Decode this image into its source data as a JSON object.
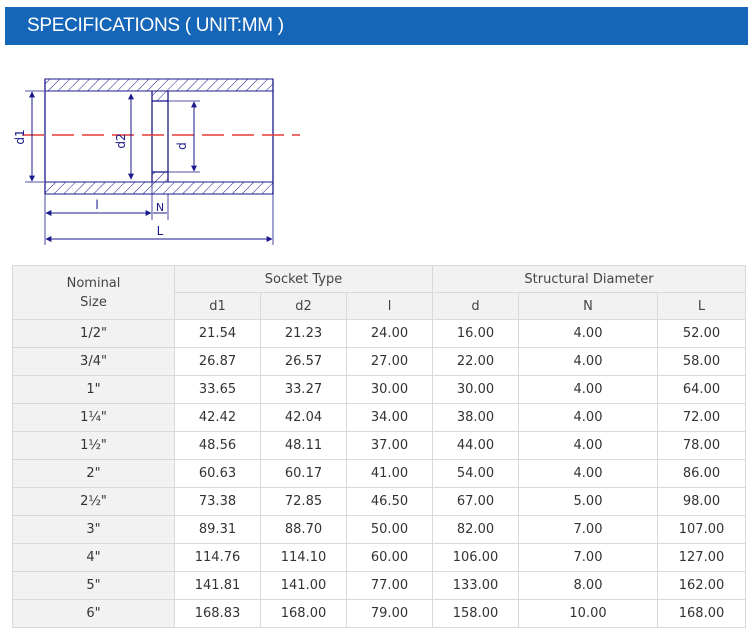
{
  "header": {
    "title": "SPECIFICATIONS ( UNIT:MM )"
  },
  "diagram": {
    "labels": {
      "d1": "d1",
      "d2": "d2",
      "d": "d",
      "l": "l",
      "N": "N",
      "L": "L"
    },
    "line_color": "#1a1a8c",
    "center_line_color": "#e53935"
  },
  "table": {
    "nominal_line1": "Nominal",
    "nominal_line2": "Size",
    "group_socket": "Socket Type",
    "group_structural": "Structural Diameter",
    "columns": [
      "d1",
      "d2",
      "l",
      "d",
      "N",
      "L"
    ],
    "rows": [
      {
        "size": "1/2\"",
        "d1": "21.54",
        "d2": "21.23",
        "l": "24.00",
        "d": "16.00",
        "N": "4.00",
        "L": "52.00"
      },
      {
        "size": "3/4\"",
        "d1": "26.87",
        "d2": "26.57",
        "l": "27.00",
        "d": "22.00",
        "N": "4.00",
        "L": "58.00"
      },
      {
        "size": "1\"",
        "d1": "33.65",
        "d2": "33.27",
        "l": "30.00",
        "d": "30.00",
        "N": "4.00",
        "L": "64.00"
      },
      {
        "size": "1¼\"",
        "d1": "42.42",
        "d2": "42.04",
        "l": "34.00",
        "d": "38.00",
        "N": "4.00",
        "L": "72.00"
      },
      {
        "size": "1½\"",
        "d1": "48.56",
        "d2": "48.11",
        "l": "37.00",
        "d": "44.00",
        "N": "4.00",
        "L": "78.00"
      },
      {
        "size": "2\"",
        "d1": "60.63",
        "d2": "60.17",
        "l": "41.00",
        "d": "54.00",
        "N": "4.00",
        "L": "86.00"
      },
      {
        "size": "2½\"",
        "d1": "73.38",
        "d2": "72.85",
        "l": "46.50",
        "d": "67.00",
        "N": "5.00",
        "L": "98.00"
      },
      {
        "size": "3\"",
        "d1": "89.31",
        "d2": "88.70",
        "l": "50.00",
        "d": "82.00",
        "N": "7.00",
        "L": "107.00"
      },
      {
        "size": "4\"",
        "d1": "114.76",
        "d2": "114.10",
        "l": "60.00",
        "d": "106.00",
        "N": "7.00",
        "L": "127.00"
      },
      {
        "size": "5\"",
        "d1": "141.81",
        "d2": "141.00",
        "l": "77.00",
        "d": "133.00",
        "N": "8.00",
        "L": "162.00"
      },
      {
        "size": "6\"",
        "d1": "168.83",
        "d2": "168.00",
        "l": "79.00",
        "d": "158.00",
        "N": "10.00",
        "L": "168.00"
      }
    ]
  }
}
